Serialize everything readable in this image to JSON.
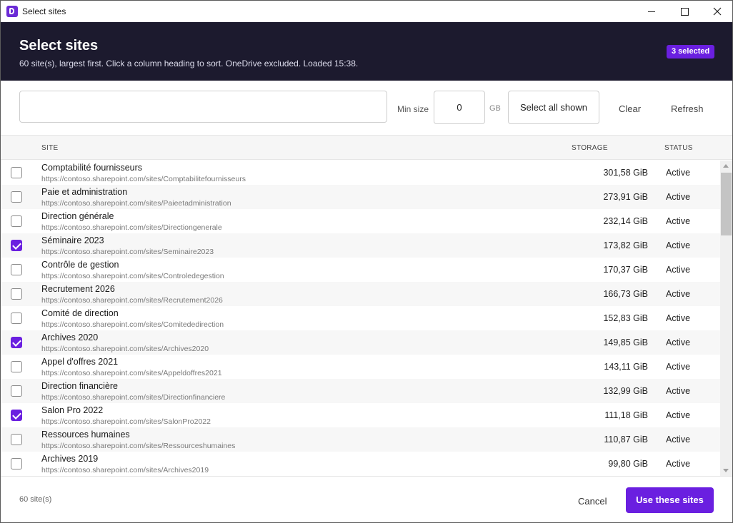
{
  "window": {
    "title": "Select sites",
    "icon": "app-logo-icon"
  },
  "header": {
    "title": "Select sites",
    "subtitle": "60 site(s), largest first. Click a column heading to sort. OneDrive excluded. Loaded 15:38.",
    "selected_badge": "3 selected"
  },
  "toolbar": {
    "search_value": "",
    "min_size_label": "Min size",
    "min_size_value": "0",
    "unit_label": "GB",
    "select_all_label": "Select all shown",
    "clear_label": "Clear",
    "refresh_label": "Refresh"
  },
  "table": {
    "columns": {
      "site": "SITE",
      "storage": "STORAGE",
      "status": "STATUS"
    },
    "rows": [
      {
        "name": "Comptabilité fournisseurs",
        "url": "https://contoso.sharepoint.com/sites/Comptabilitefournisseurs",
        "storage": "301,58 GiB",
        "status": "Active",
        "checked": false
      },
      {
        "name": "Paie et administration",
        "url": "https://contoso.sharepoint.com/sites/Paieetadministration",
        "storage": "273,91 GiB",
        "status": "Active",
        "checked": false
      },
      {
        "name": "Direction générale",
        "url": "https://contoso.sharepoint.com/sites/Directiongenerale",
        "storage": "232,14 GiB",
        "status": "Active",
        "checked": false
      },
      {
        "name": "Séminaire 2023",
        "url": "https://contoso.sharepoint.com/sites/Seminaire2023",
        "storage": "173,82 GiB",
        "status": "Active",
        "checked": true
      },
      {
        "name": "Contrôle de gestion",
        "url": "https://contoso.sharepoint.com/sites/Controledegestion",
        "storage": "170,37 GiB",
        "status": "Active",
        "checked": false
      },
      {
        "name": "Recrutement 2026",
        "url": "https://contoso.sharepoint.com/sites/Recrutement2026",
        "storage": "166,73 GiB",
        "status": "Active",
        "checked": false
      },
      {
        "name": "Comité de direction",
        "url": "https://contoso.sharepoint.com/sites/Comitededirection",
        "storage": "152,83 GiB",
        "status": "Active",
        "checked": false
      },
      {
        "name": "Archives 2020",
        "url": "https://contoso.sharepoint.com/sites/Archives2020",
        "storage": "149,85 GiB",
        "status": "Active",
        "checked": true
      },
      {
        "name": "Appel d'offres 2021",
        "url": "https://contoso.sharepoint.com/sites/Appeldoffres2021",
        "storage": "143,11 GiB",
        "status": "Active",
        "checked": false
      },
      {
        "name": "Direction financière",
        "url": "https://contoso.sharepoint.com/sites/Directionfinanciere",
        "storage": "132,99 GiB",
        "status": "Active",
        "checked": false
      },
      {
        "name": "Salon Pro 2022",
        "url": "https://contoso.sharepoint.com/sites/SalonPro2022",
        "storage": "111,18 GiB",
        "status": "Active",
        "checked": true
      },
      {
        "name": "Ressources humaines",
        "url": "https://contoso.sharepoint.com/sites/Ressourceshumaines",
        "storage": "110,87 GiB",
        "status": "Active",
        "checked": false
      },
      {
        "name": "Archives 2019",
        "url": "https://contoso.sharepoint.com/sites/Archives2019",
        "storage": "99,80 GiB",
        "status": "Active",
        "checked": false
      }
    ]
  },
  "footer": {
    "count": "60 site(s)",
    "cancel_label": "Cancel",
    "use_label": "Use these sites"
  },
  "colors": {
    "accent": "#6a1fe0",
    "header_bg": "#1c1a2e"
  }
}
